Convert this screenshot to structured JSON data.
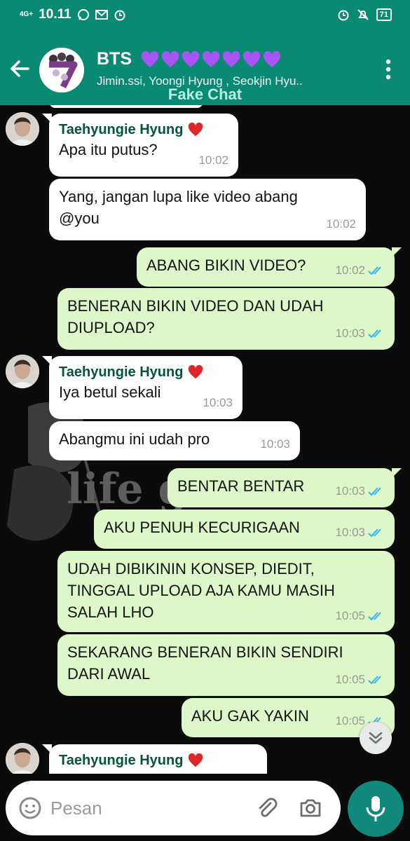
{
  "status_bar": {
    "network": "4G+",
    "time": "10.11",
    "battery": "71"
  },
  "header": {
    "group_name": "BTS",
    "heart_count": 7,
    "members": "Jimin.ssi, Yoongi Hyung , Seokjin Hyu..",
    "watermark": "Fake Chat"
  },
  "colors": {
    "header_bg": "#0b8a73",
    "incoming_bubble": "#ffffff",
    "outgoing_bubble": "#ddf7c8",
    "sender_name": "#07533f",
    "read_tick": "#34b7f1",
    "mic_button": "#10897a"
  },
  "background": {
    "text": "life go"
  },
  "messages": [
    {
      "direction": "in",
      "sender": "Taehyungie Hyung",
      "sender_badge": "heart-icon",
      "text": "Apa itu putus?",
      "time": "10:02"
    },
    {
      "direction": "in",
      "text": "Yang, jangan lupa like video abang\n@you",
      "time": "10:02"
    },
    {
      "direction": "out",
      "text": "ABANG BIKIN VIDEO?",
      "time": "10:02",
      "status": "read"
    },
    {
      "direction": "out",
      "text": "BENERAN BIKIN VIDEO DAN UDAH\nDIUPLOAD?",
      "time": "10:03",
      "status": "read"
    },
    {
      "direction": "in",
      "sender": "Taehyungie Hyung",
      "sender_badge": "heart-icon",
      "text": "Iya betul sekali",
      "time": "10:03"
    },
    {
      "direction": "in",
      "text": "Abangmu ini udah pro",
      "time": "10:03"
    },
    {
      "direction": "out",
      "text": "BENTAR BENTAR",
      "time": "10:03",
      "status": "read"
    },
    {
      "direction": "out",
      "text": "AKU PENUH KECURIGAAN",
      "time": "10:03",
      "status": "read"
    },
    {
      "direction": "out",
      "text": "UDAH DIBIKININ KONSEP, DIEDIT,\nTINGGAL UPLOAD AJA KAMU MASIH\nSALAH LHO",
      "time": "10:05",
      "status": "read"
    },
    {
      "direction": "out",
      "text": "SEKARANG BENERAN BIKIN SENDIRI\nDARI AWAL",
      "time": "10:05",
      "status": "read"
    },
    {
      "direction": "out",
      "text": "AKU GAK YAKIN",
      "time": "10:05",
      "status": "read"
    },
    {
      "direction": "in",
      "sender": "Taehyungie Hyung",
      "sender_badge": "heart-icon",
      "text": "",
      "time": ""
    }
  ],
  "composer": {
    "placeholder": "Pesan"
  }
}
